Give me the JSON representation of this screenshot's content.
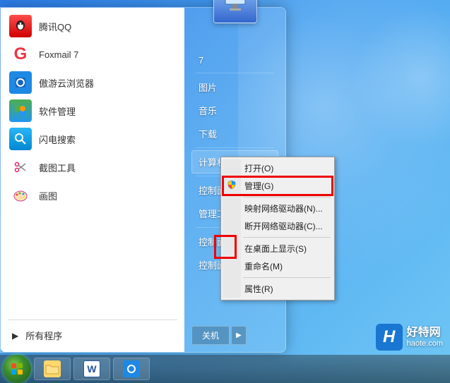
{
  "start_menu": {
    "programs": [
      {
        "icon": "qq",
        "label": "腾讯QQ"
      },
      {
        "icon": "foxmail",
        "label": "Foxmail 7"
      },
      {
        "icon": "maxthon",
        "label": "傲游云浏览器"
      },
      {
        "icon": "softmgr",
        "label": "软件管理"
      },
      {
        "icon": "flash",
        "label": "闪电搜索"
      },
      {
        "icon": "snip",
        "label": "截图工具"
      },
      {
        "icon": "paint",
        "label": "画图"
      }
    ],
    "all_programs": "所有程序"
  },
  "right_panel": {
    "user_label": "7",
    "items": [
      {
        "label": "图片"
      },
      {
        "label": "音乐"
      },
      {
        "label": "下载"
      },
      {
        "label": "计算机",
        "highlighted": true
      },
      {
        "label": "控制面板"
      },
      {
        "label": "管理工具"
      },
      {
        "label": "控制面板\\桌面"
      },
      {
        "label": "控制面板\\示(S)"
      }
    ],
    "shutdown": "关机"
  },
  "context_menu": {
    "items": [
      {
        "label": "打开(O)"
      },
      {
        "label": "管理(G)",
        "shield": true,
        "highlighted": true
      },
      {
        "sep": true
      },
      {
        "label": "映射网络驱动器(N)..."
      },
      {
        "label": "断开网络驱动器(C)..."
      },
      {
        "sep": true
      },
      {
        "label": "在桌面上显示(S)"
      },
      {
        "label": "重命名(M)"
      },
      {
        "sep": true
      },
      {
        "label": "属性(R)"
      }
    ]
  },
  "taskbar": {
    "buttons": [
      "explorer",
      "word",
      "maxthon"
    ]
  },
  "watermark": {
    "badge": "H",
    "name": "好特网",
    "url": "haote.com"
  }
}
